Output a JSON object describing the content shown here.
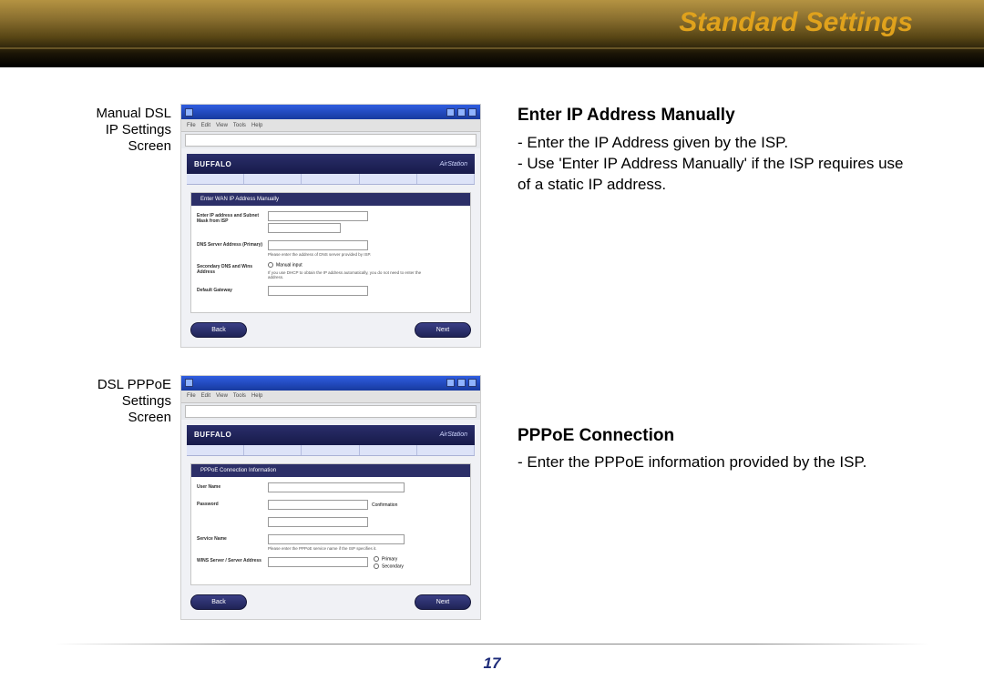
{
  "banner": {
    "title": "Standard Settings"
  },
  "row1": {
    "label_l1": "Manual DSL",
    "label_l2": "IP Settings",
    "label_l3": "Screen",
    "heading": "Enter IP Address Manually",
    "bullet1": "- Enter the IP Address given by the ISP.",
    "bullet2": "- Use 'Enter IP Address Manually' if the ISP requires use of a static IP address."
  },
  "row2": {
    "label_l1": "DSL PPPoE",
    "label_l2": "Settings",
    "label_l3": "Screen",
    "heading": "PPPoE Connection",
    "bullet1": "- Enter the PPPoE information provided by the ISP."
  },
  "shot": {
    "brand": "BUFFALO",
    "station": "AirStation",
    "hd1": "Enter WAN IP Address Manually",
    "hd2": "PPPoE Connection Information",
    "back": "Back",
    "next": "Next",
    "f_ip": "Enter IP address and Subnet Mask from ISP",
    "f_dns": "DNS Server Address (Primary)",
    "f_dns2": "Secondary DNS and Wins Address",
    "f_gw": "Default Gateway",
    "f_user": "User Name",
    "f_pass": "Password",
    "f_conf": "Confirmation",
    "f_svc": "Service Name",
    "f_wins": "WINS Server / Server Address",
    "opt_manual": "Manual input",
    "opt_primary": "Primary",
    "opt_secondary": "Secondary",
    "tiny1": "Please enter the address of DNS server provided by ISP.",
    "tiny2": "If you use DHCP to obtain the IP address automatically, you do not need to enter the address.",
    "tiny3": "Please enter the PPPoE service name if the ISP specifies it."
  },
  "footer": {
    "page": "17"
  }
}
